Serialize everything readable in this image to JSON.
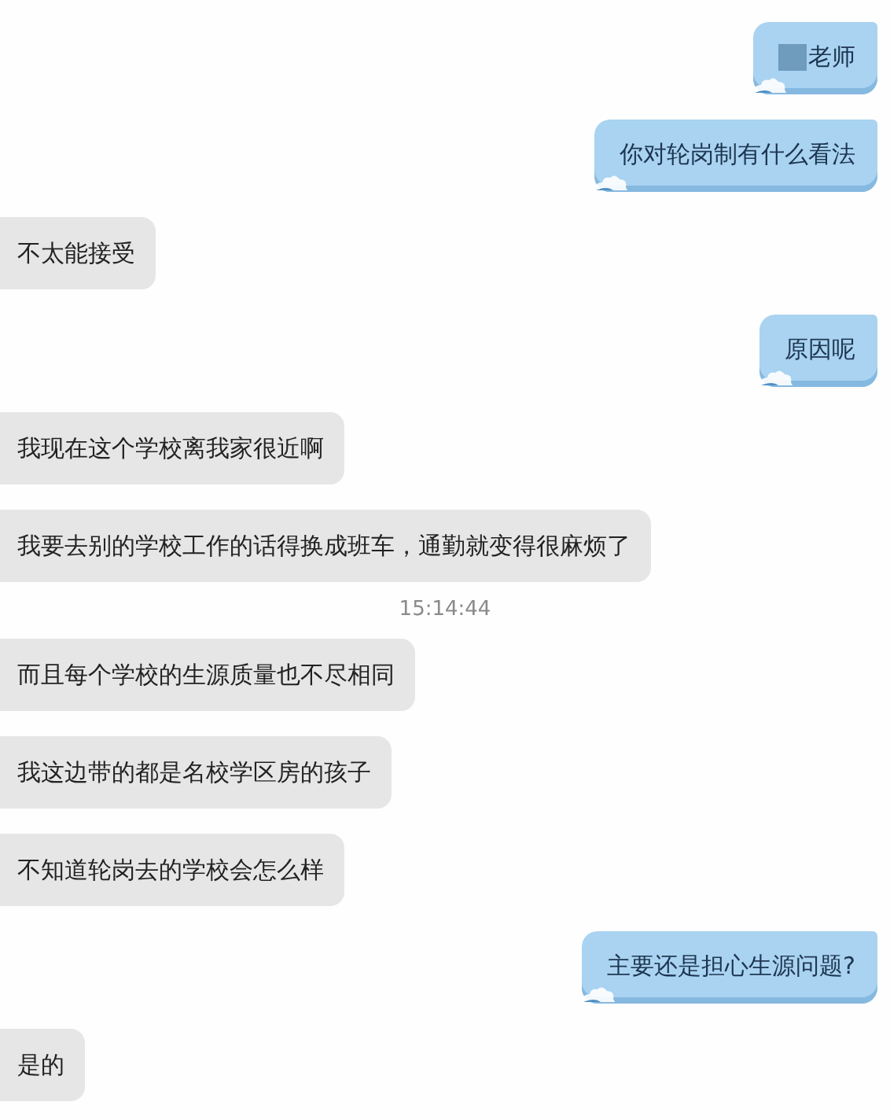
{
  "messages": [
    {
      "kind": "sent",
      "text": "老师",
      "redacted": true
    },
    {
      "kind": "sent",
      "text": "你对轮岗制有什么看法",
      "redacted": false
    },
    {
      "kind": "received",
      "text": "不太能接受"
    },
    {
      "kind": "sent",
      "text": "原因呢",
      "redacted": false
    },
    {
      "kind": "received",
      "text": "我现在这个学校离我家很近啊"
    },
    {
      "kind": "received",
      "text": "我要去别的学校工作的话得换成班车，通勤就变得很麻烦了"
    },
    {
      "kind": "time",
      "text": "15:14:44"
    },
    {
      "kind": "received",
      "text": "而且每个学校的生源质量也不尽相同"
    },
    {
      "kind": "received",
      "text": "我这边带的都是名校学区房的孩子"
    },
    {
      "kind": "received",
      "text": "不知道轮岗去的学校会怎么样"
    },
    {
      "kind": "sent",
      "text": "主要还是担心生源问题?",
      "redacted": false
    },
    {
      "kind": "received",
      "text": "是的"
    }
  ]
}
